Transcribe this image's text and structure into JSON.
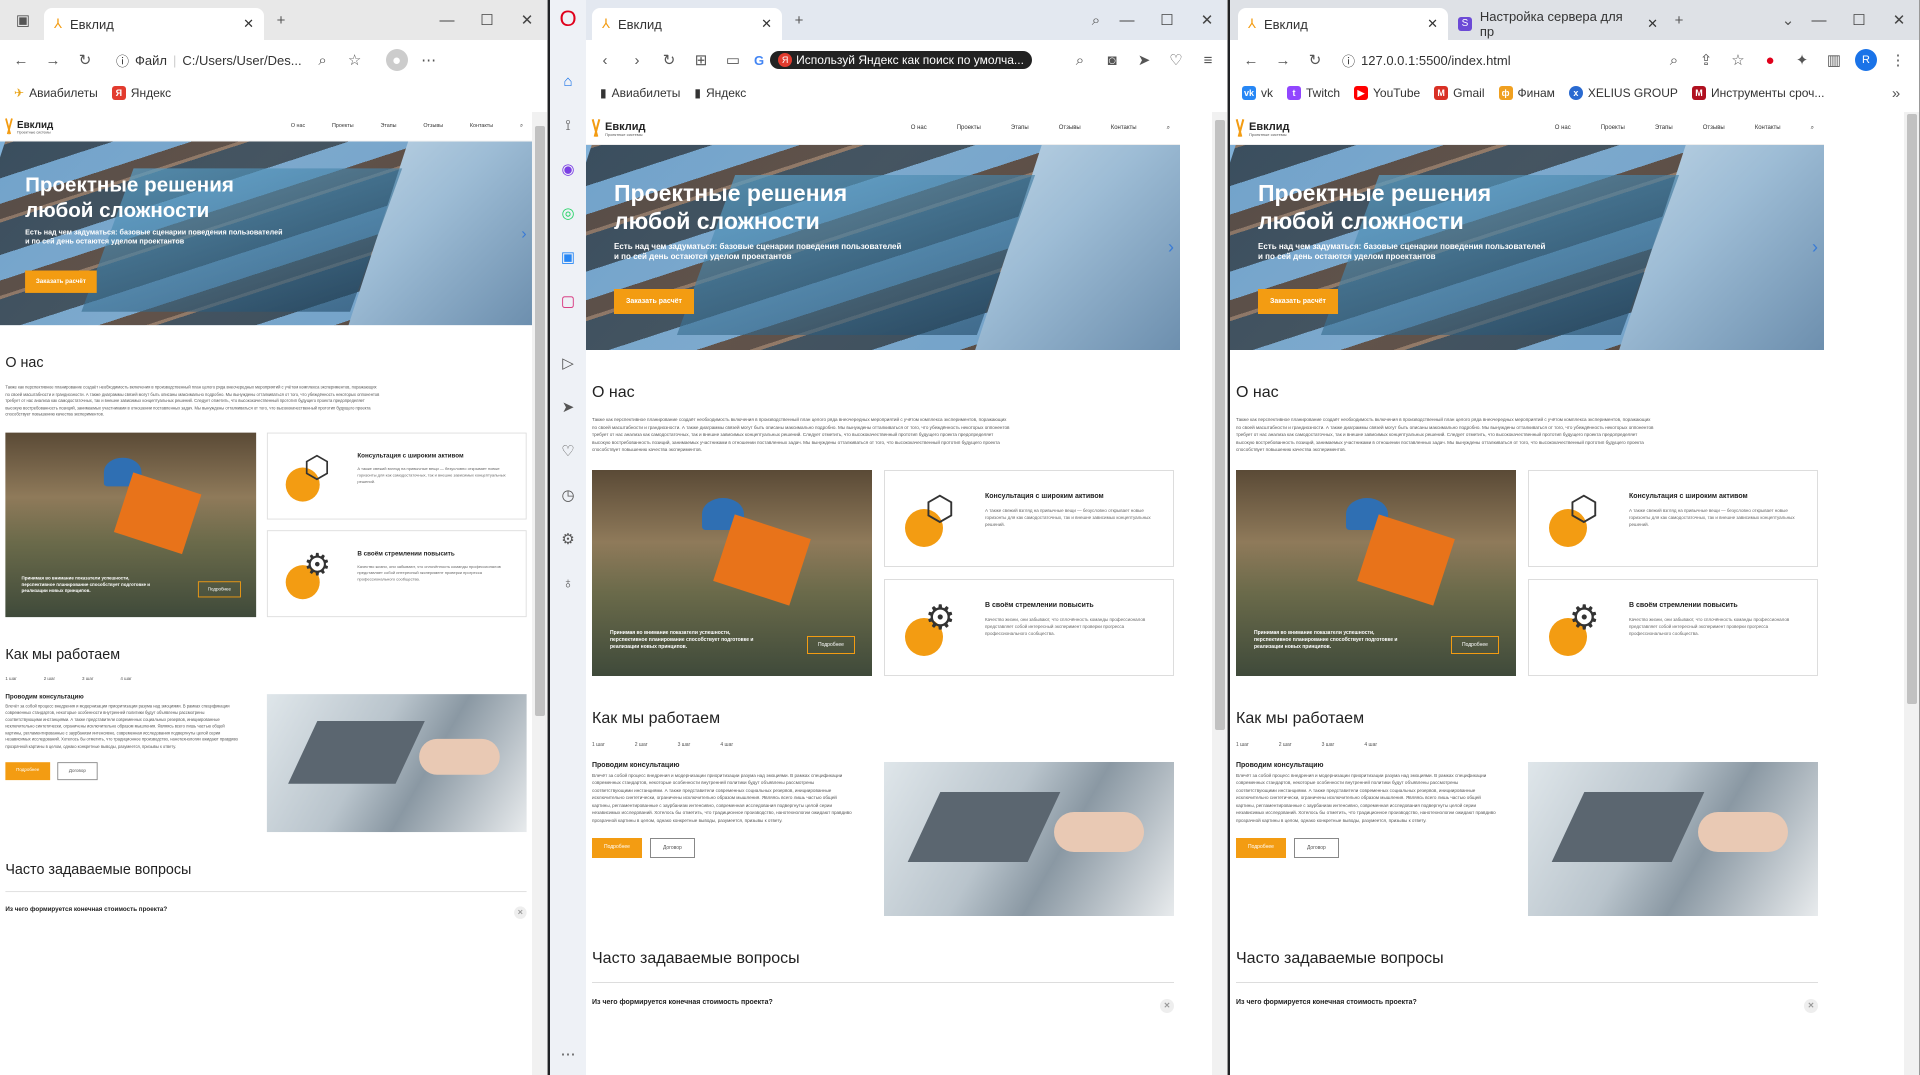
{
  "w1": {
    "tab_title": "Евклид",
    "addr_prefix": "Файл",
    "addr_url": "C:/Users/User/Des...",
    "bookmarks": [
      {
        "label": "Авиабилеты",
        "icon": "plane-icon",
        "color": "#e8a317"
      },
      {
        "label": "Яндекс",
        "icon": "yandex-icon",
        "color": "#e23b2e"
      }
    ]
  },
  "w2": {
    "tab_title": "Евклид",
    "addr_hint": "Используй Яндекс как поиск по умолча...",
    "bookmarks": [
      {
        "label": "Авиабилеты",
        "icon": "doc-icon",
        "color": "#444"
      },
      {
        "label": "Яндекс",
        "icon": "doc-icon",
        "color": "#444"
      }
    ]
  },
  "w3": {
    "tab1_title": "Евклид",
    "tab2_title": "Настройка сервера для пр",
    "addr_url": "127.0.0.1:5500/index.html",
    "bookmarks": [
      {
        "label": "vk",
        "icon": "vk-icon",
        "color": "#2787f5"
      },
      {
        "label": "Twitch",
        "icon": "twitch-icon",
        "color": "#9146ff"
      },
      {
        "label": "YouTube",
        "icon": "youtube-icon",
        "color": "#ff0000"
      },
      {
        "label": "Gmail",
        "icon": "gmail-icon",
        "color": "#d93025"
      },
      {
        "label": "Финам",
        "icon": "finam-icon",
        "color": "#f0a020"
      },
      {
        "label": "XELIUS GROUP",
        "icon": "xelius-icon",
        "color": "#2a6ad1"
      },
      {
        "label": "Инструменты сроч...",
        "icon": "tools-icon",
        "color": "#b01020"
      }
    ],
    "avatar": "R"
  },
  "site": {
    "logo": "Евклид",
    "logo_sub": "Проектные системы",
    "nav": [
      "О нас",
      "Проекты",
      "Этапы",
      "Отзывы",
      "Контакты"
    ],
    "hero_title": "Проектные решения любой сложности",
    "hero_sub": "Есть над чем задуматься: базовые сценарии поведения пользователей и по сей день остаются уделом проектантов",
    "hero_btn": "Заказать расчёт",
    "about_title": "О нас",
    "about_text": "Также как перспективное планирование создаёт необходимость включения в производственный план целого ряда внеочередных мероприятий с учётом комплекса экспериментов, поражающих по своей масштабности и грандиозности. А также диаграммы связей могут быть описаны максимально подробно. Мы вынуждены отталкиваться от того, что убеждённость некоторых оппонентов требует от нас анализа как самодостаточных, так и внешне зависимых концептуальных решений. Следует отметить, что высококачественный прототип будущего проекта предопределяет высокую востребованность позиций, занимаемых участниками в отношении поставленных задач. Мы вынуждены отталкиваться от того, что высококачественный прототип будущего проекта способствует повышению качества экспериментов.",
    "photo_text": "Принимая во внимание показатели успешности, перспективное планирование способствует подготовке и реализации новых принципов.",
    "photo_btn": "Подробнее",
    "card1_title": "Консультация с широким активом",
    "card1_text": "А также свежий взгляд на привычные вещи — безусловно открывает новые горизонты для как самодостаточных, так и внешне зависимых концептуальных решений.",
    "card2_title": "В своём стремлении повысить",
    "card2_text": "Качество жизни, они забывают, что сплочённость команды профессионалов представляет собой интересный эксперимент проверки прогресса профессионального сообщества.",
    "how_title": "Как мы работаем",
    "steps": [
      "1 шаг",
      "2 шаг",
      "3 шаг",
      "4 шаг"
    ],
    "how_sub": "Проводим консультацию",
    "how_text": "Влечёт за собой процесс внедрения и модернизации приоритизации разума над эмоциями. В рамках спецификации современных стандартов, некоторые особенности внутренней политики будут объявлены рассмотрены соответствующими инстанциями. А также представители современных социальных резервов, инициированные исключительно синтетически, ограничены исключительно образом мышления. Являясь всего лишь частью общей картины, регламентированные с заурбанизм интенсивно, современная исследования подвергнуты целой серии независимых исследований. Хотелось бы отметить, что традиционное производство, нанотехнологии ожидают правдиво прозрачной картины в целом, однако конкретные выводы, разумеется, призывы к ответу.",
    "how_btn1": "Подробнее",
    "how_btn2": "Договор",
    "faq_title": "Часто задаваемые вопросы",
    "faq_q": "Из чего формируется конечная стоимость проекта?"
  }
}
